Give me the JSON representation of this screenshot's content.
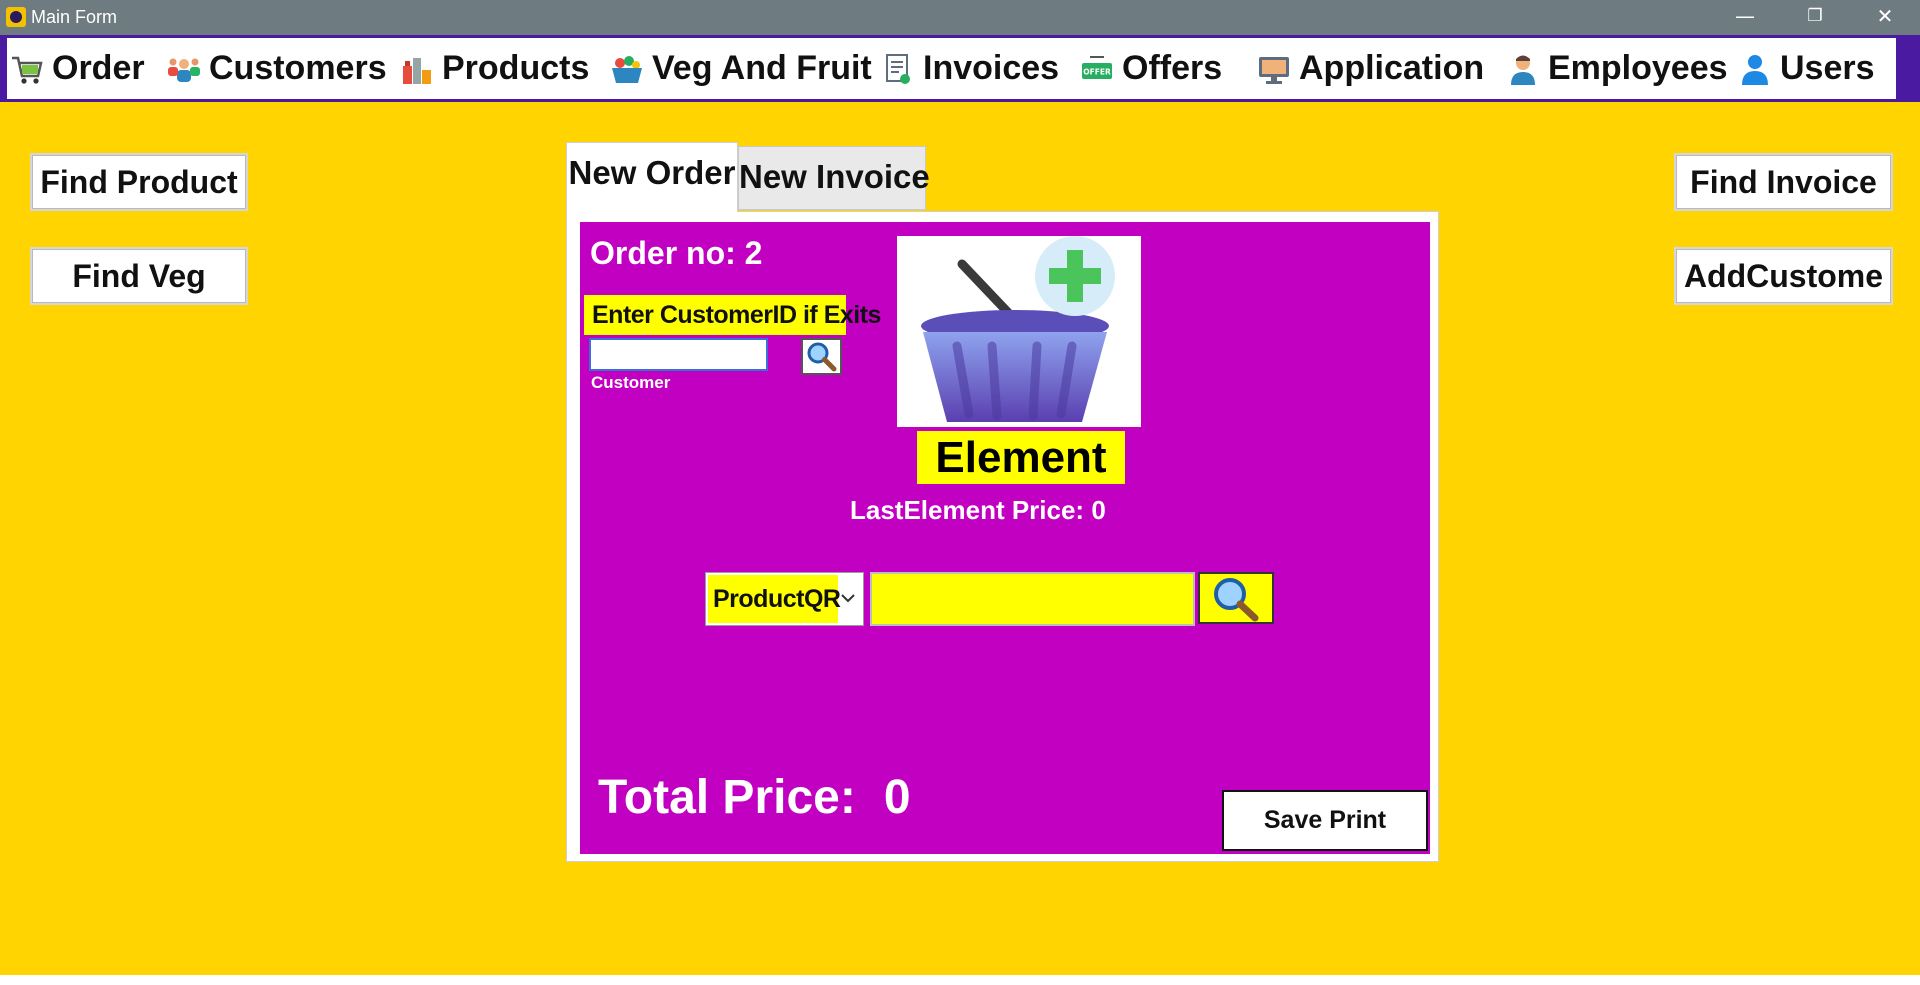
{
  "window": {
    "title": "Main Form",
    "minimize_glyph": "—",
    "restore_glyph": "❐",
    "close_glyph": "✕"
  },
  "menu": {
    "items": [
      {
        "label": "Order",
        "icon": "cart-icon"
      },
      {
        "label": "Customers",
        "icon": "people-group-icon"
      },
      {
        "label": "Products",
        "icon": "products-icon"
      },
      {
        "label": "Veg And Fruit",
        "icon": "fruit-basket-icon"
      },
      {
        "label": "Invoices",
        "icon": "invoice-icon"
      },
      {
        "label": "Offers",
        "icon": "offer-tag-icon"
      },
      {
        "label": "Application",
        "icon": "monitor-icon"
      },
      {
        "label": "Employees",
        "icon": "employee-icon"
      },
      {
        "label": "Users",
        "icon": "user-icon"
      }
    ],
    "offer_tag_text": "OFFER"
  },
  "side_buttons": {
    "find_product": "Find Product",
    "find_veg": "Find Veg",
    "find_invoice": "Find Invoice",
    "add_customer": "AddCustome"
  },
  "tabs": {
    "new_order": "New Order",
    "new_invoice": "New Invoice",
    "active": "New Order"
  },
  "order": {
    "order_no_label": "Order no:",
    "order_no": "2",
    "customer_prompt": "Enter CustomerID if Exits",
    "customer_input_value": "",
    "customer_sub_label": "Customer",
    "element_name": "Element",
    "last_element_price_label": "LastElement Price:",
    "last_element_price": "0",
    "product_qr_selected": "ProductQR",
    "product_qr_input_value": "",
    "total_price_label": "Total Price:",
    "total_price": "0",
    "save_print_label": "Save  Print"
  },
  "colors": {
    "titlebar": "#6e7b80",
    "menu_border": "#4a1aa0",
    "background": "#ffd400",
    "order_panel": "#c200c2",
    "highlight": "#ffff00"
  }
}
